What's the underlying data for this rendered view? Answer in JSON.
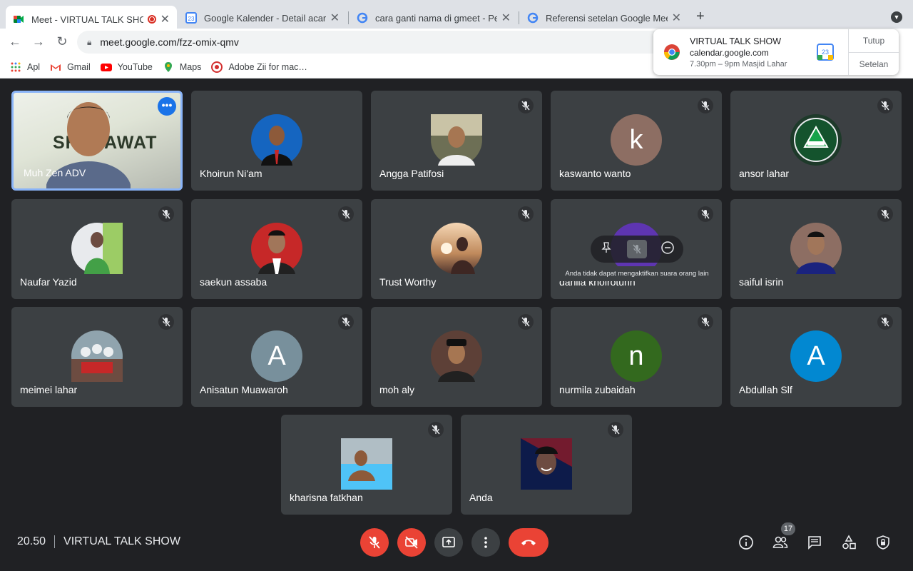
{
  "browser": {
    "tabs": [
      {
        "title": "Meet - VIRTUAL TALK SHO",
        "favicon": "meet-icon",
        "active": true
      },
      {
        "title": "Google Kalender - Detail acara",
        "favicon": "calendar-icon",
        "active": false
      },
      {
        "title": "cara ganti nama di gmeet - Per",
        "favicon": "google-icon",
        "active": false
      },
      {
        "title": "Referensi setelan Google Meet",
        "favicon": "google-icon",
        "active": false
      }
    ],
    "url": "meet.google.com/fzz-omix-qmv",
    "bookmarks": [
      {
        "label": "Apl",
        "icon": "apps-grid-icon"
      },
      {
        "label": "Gmail",
        "icon": "gmail-icon"
      },
      {
        "label": "YouTube",
        "icon": "youtube-icon"
      },
      {
        "label": "Maps",
        "icon": "maps-icon"
      },
      {
        "label": "Adobe Zii for mac…",
        "icon": "adobe-icon"
      }
    ]
  },
  "notification": {
    "title": "VIRTUAL TALK SHOW",
    "source": "calendar.google.com",
    "message": "7.30pm – 9pm Masjid Lahar",
    "close_label": "Tutup",
    "settings_label": "Setelan",
    "calendar_day": "23"
  },
  "participants": [
    {
      "name": "Muh Zen ADV",
      "video": true,
      "banner": "SHALAWAT"
    },
    {
      "name": "Khoirun Ni'am",
      "avatar_color": "#1565c0",
      "initial": ""
    },
    {
      "name": "Angga Patifosi",
      "avatar_color": "#6d6f55",
      "initial": ""
    },
    {
      "name": "kaswanto wanto",
      "avatar_color": "#8d6e63",
      "initial": "k"
    },
    {
      "name": "ansor lahar",
      "avatar_color": "#1e3a2a",
      "initial": ""
    },
    {
      "name": "Naufar Yazid",
      "avatar_color": "#7cb342",
      "initial": ""
    },
    {
      "name": "saekun assaba",
      "avatar_color": "#c62828",
      "initial": ""
    },
    {
      "name": "Trust Worthy",
      "avatar_color": "#a1887f",
      "initial": ""
    },
    {
      "name": "dahlia khoirotunn",
      "avatar_color": "#5e35b1",
      "initial": ""
    },
    {
      "name": "saiful isrin",
      "avatar_color": "#8d6e63",
      "initial": ""
    },
    {
      "name": "meimei lahar",
      "avatar_color": "#90a4ae",
      "initial": ""
    },
    {
      "name": "Anisatun Muawaroh",
      "avatar_color": "#78909c",
      "initial": "A"
    },
    {
      "name": "moh aly",
      "avatar_color": "#5d4037",
      "initial": ""
    },
    {
      "name": "nurmila zubaidah",
      "avatar_color": "#33691e",
      "initial": "n"
    },
    {
      "name": "Abdullah Slf",
      "avatar_color": "#0288d1",
      "initial": "A"
    },
    {
      "name": "kharisna fatkhan",
      "avatar_color": "#546e7a",
      "initial": ""
    },
    {
      "name": "Anda",
      "avatar_color": "#1a237e",
      "initial": ""
    }
  ],
  "tooltip": "Anda tidak dapat mengaktifkan suara orang lain",
  "bottom_bar": {
    "time": "20.50",
    "meeting_title": "VIRTUAL TALK SHOW",
    "participant_count": "17"
  }
}
